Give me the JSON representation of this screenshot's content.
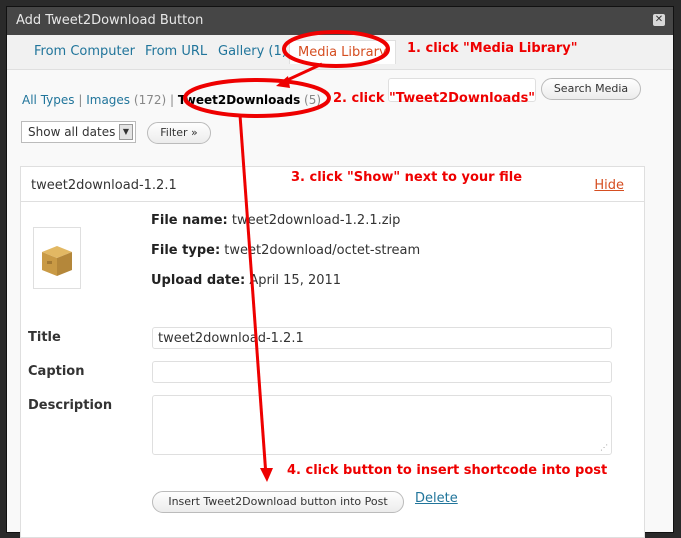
{
  "dialog": {
    "title": "Add Tweet2Download Button",
    "close_glyph": "✕"
  },
  "tabs": [
    {
      "label": "From Computer"
    },
    {
      "label": "From URL"
    },
    {
      "label": "Gallery (1)"
    },
    {
      "label": "Media Library"
    }
  ],
  "filters": {
    "all_types": "All Types",
    "sep": "|",
    "images": "Images",
    "images_count": "(172)",
    "current": "Tweet2Downloads",
    "current_count": "(5)"
  },
  "search": {
    "value": "",
    "button_label": "Search Media"
  },
  "dates": {
    "selected": "Show all dates"
  },
  "filter_button": "Filter »",
  "item": {
    "name": "tweet2download-1.2.1",
    "hide_label": "Hide",
    "file_name_label": "File name:",
    "file_name": "tweet2download-1.2.1.zip",
    "file_type_label": "File type:",
    "file_type": "tweet2download/octet-stream",
    "upload_date_label": "Upload date:",
    "upload_date": "April 15, 2011",
    "title_label": "Title",
    "title_value": "tweet2download-1.2.1",
    "caption_label": "Caption",
    "caption_value": "",
    "description_label": "Description",
    "description_value": "",
    "insert_label": "Insert Tweet2Download button into Post",
    "delete_label": "Delete"
  },
  "annotations": {
    "step1": "1. click \"Media Library\"",
    "step2": "2. click \"Tweet2Downloads\"",
    "step3": "3. click \"Show\" next to your file",
    "step4": "4. click button to insert shortcode into post",
    "color": "#e00000"
  },
  "icons": {
    "file_thumbnail": "package-box-icon",
    "resize": "resize-grip-icon"
  }
}
